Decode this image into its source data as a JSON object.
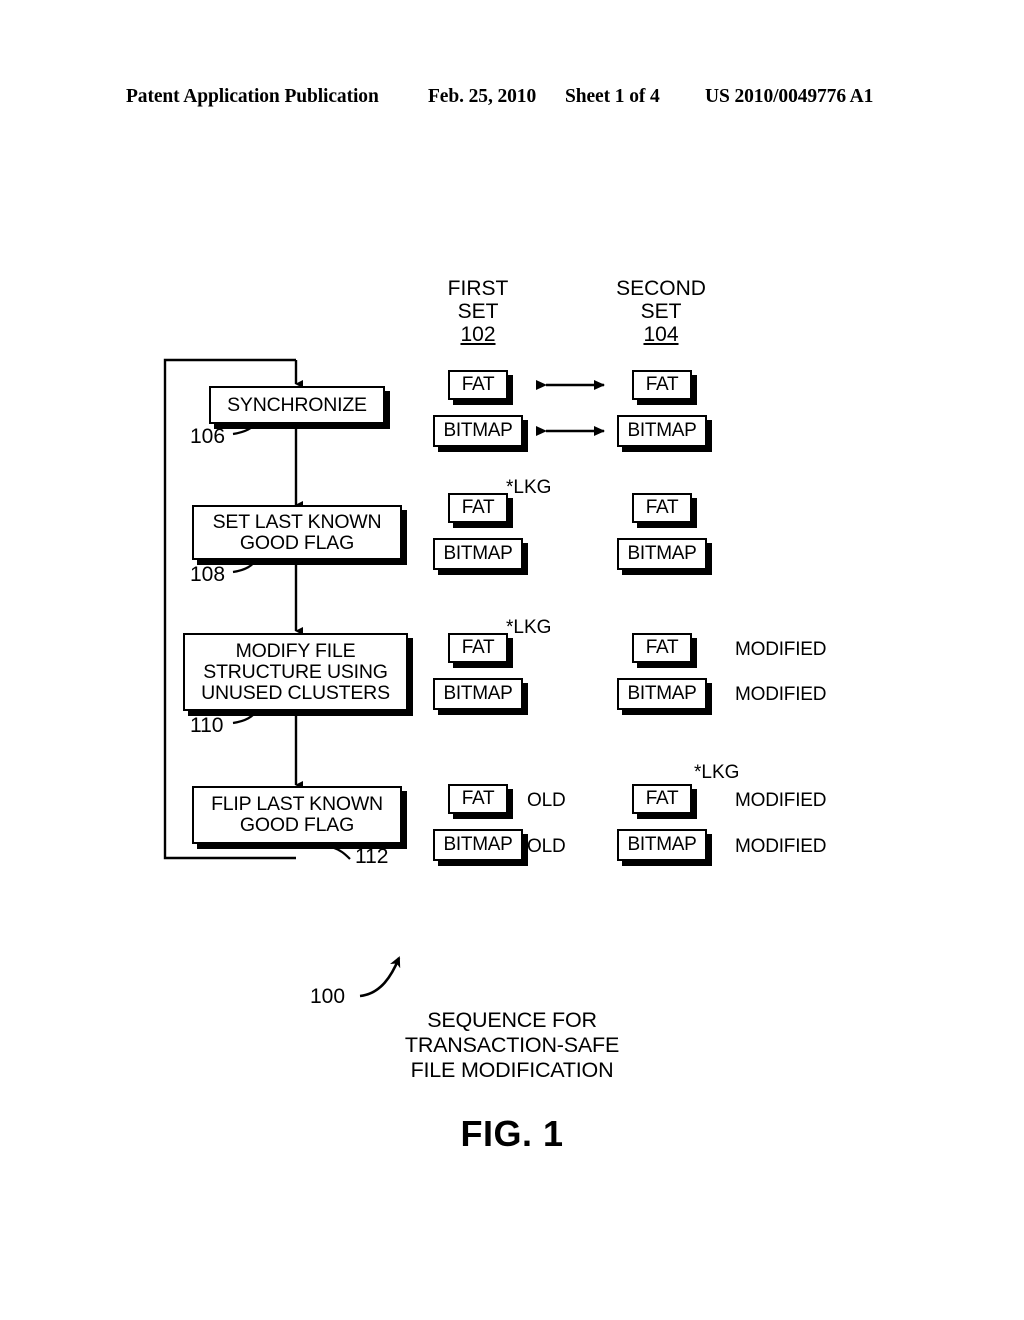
{
  "header": {
    "publication": "Patent Application Publication",
    "date": "Feb. 25, 2010",
    "sheet": "Sheet 1 of 4",
    "publication_number": "US 2010/0049776 A1"
  },
  "figure": {
    "label": "FIG. 1",
    "caption": {
      "ref": "100",
      "line1": "SEQUENCE FOR",
      "line2": "TRANSACTION-SAFE",
      "line3": "FILE MODIFICATION"
    },
    "columns": [
      {
        "name": "first-set",
        "line1": "FIRST",
        "line2": "SET",
        "ref": "102"
      },
      {
        "name": "second-set",
        "line1": "SECOND",
        "line2": "SET",
        "ref": "104"
      }
    ],
    "steps": [
      {
        "name": "synchronize",
        "ref": "106",
        "text": "SYNCHRONIZE"
      },
      {
        "name": "set-last-known-good-flag",
        "ref": "108",
        "text": "SET LAST KNOWN GOOD FLAG"
      },
      {
        "name": "modify-file-structure",
        "ref": "110",
        "text": "MODIFY FILE STRUCTURE USING UNUSED CLUSTERS"
      },
      {
        "name": "flip-last-known-good-flag",
        "ref": "112",
        "text": "FLIP LAST KNOWN GOOD FLAG"
      }
    ],
    "rows": [
      {
        "step": "synchronize",
        "first_set": {
          "fat": "FAT",
          "bitmap": "BITMAP",
          "fat_flag": "",
          "bitmap_flag": "",
          "fat_state": "",
          "bitmap_state": ""
        },
        "second_set": {
          "fat": "FAT",
          "bitmap": "BITMAP",
          "fat_flag": "",
          "bitmap_flag": "",
          "fat_state": "",
          "bitmap_state": ""
        },
        "sync_arrows": true
      },
      {
        "step": "set-last-known-good-flag",
        "first_set": {
          "fat": "FAT",
          "bitmap": "BITMAP",
          "fat_flag": "*LKG",
          "bitmap_flag": "",
          "fat_state": "",
          "bitmap_state": ""
        },
        "second_set": {
          "fat": "FAT",
          "bitmap": "BITMAP",
          "fat_flag": "",
          "bitmap_flag": "",
          "fat_state": "",
          "bitmap_state": ""
        },
        "sync_arrows": false
      },
      {
        "step": "modify-file-structure",
        "first_set": {
          "fat": "FAT",
          "bitmap": "BITMAP",
          "fat_flag": "*LKG",
          "bitmap_flag": "",
          "fat_state": "",
          "bitmap_state": ""
        },
        "second_set": {
          "fat": "FAT",
          "bitmap": "BITMAP",
          "fat_flag": "",
          "bitmap_flag": "",
          "fat_state": "MODIFIED",
          "bitmap_state": "MODIFIED"
        },
        "sync_arrows": false
      },
      {
        "step": "flip-last-known-good-flag",
        "first_set": {
          "fat": "FAT",
          "bitmap": "BITMAP",
          "fat_flag": "",
          "bitmap_flag": "",
          "fat_state": "OLD",
          "bitmap_state": "OLD"
        },
        "second_set": {
          "fat": "FAT",
          "bitmap": "BITMAP",
          "fat_flag": "*LKG",
          "bitmap_flag": "",
          "fat_state": "MODIFIED",
          "bitmap_state": "MODIFIED"
        },
        "sync_arrows": false
      }
    ]
  }
}
